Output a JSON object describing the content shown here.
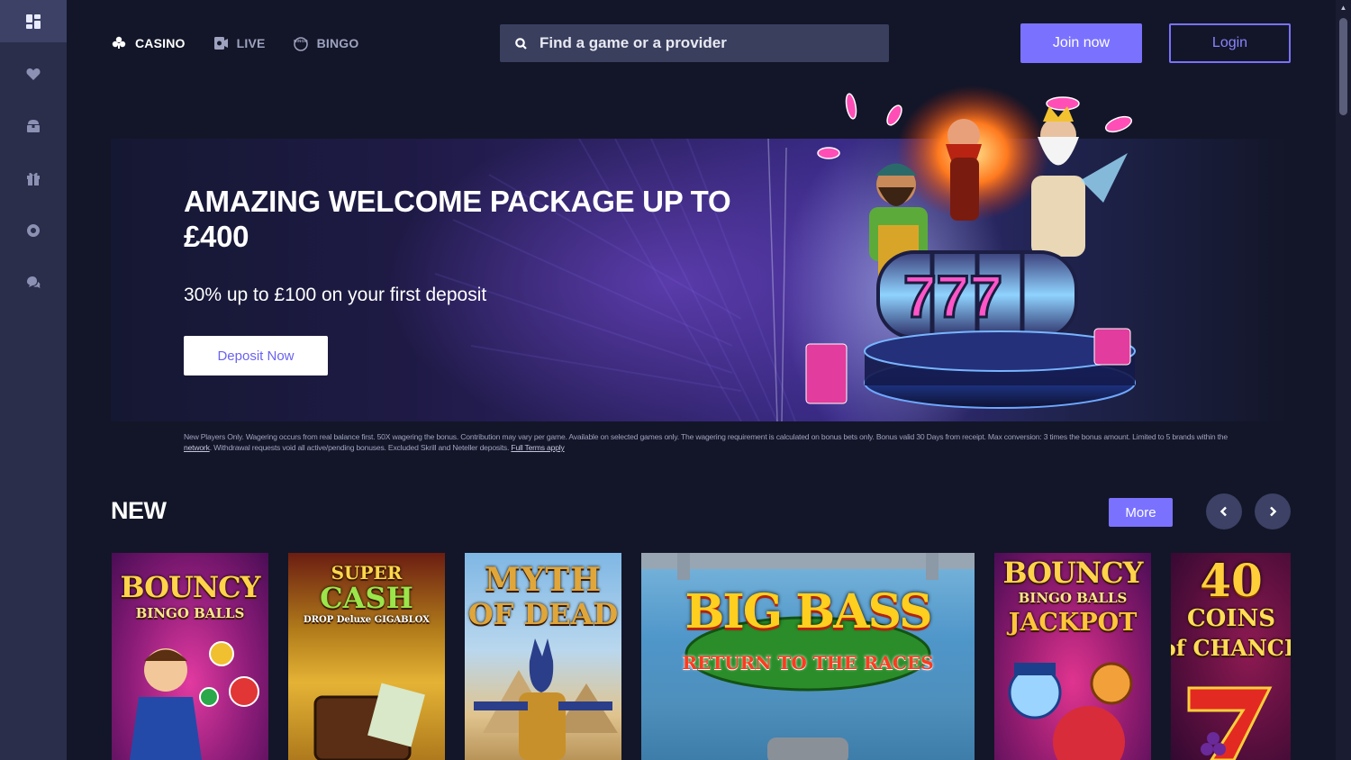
{
  "rail": {
    "items": [
      {
        "name": "games-grid-icon",
        "active": true
      },
      {
        "name": "heart-icon",
        "active": false
      },
      {
        "name": "treasure-chest-icon",
        "active": false
      },
      {
        "name": "gift-icon",
        "active": false
      },
      {
        "name": "lifebuoy-icon",
        "active": false
      },
      {
        "name": "chat-bubbles-icon",
        "active": false
      }
    ]
  },
  "nav": {
    "casino": "CASINO",
    "live": "LIVE",
    "bingo": "BINGO"
  },
  "search": {
    "placeholder": "Find a game or a provider"
  },
  "header": {
    "join_label": "Join now",
    "login_label": "Login"
  },
  "hero": {
    "title": "AMAZING WELCOME PACKAGE UP TO £400",
    "subtitle": "30% up to £100 on your first deposit",
    "cta_label": "Deposit Now",
    "reel_digits": "777"
  },
  "terms": {
    "text_a": "New Players Only. Wagering occurs from real balance first. 50X wagering the bonus. Contribution may vary per game. Available on selected games only. The wagering requirement is calculated on bonus bets only. Bonus valid 30 Days from receipt. Max conversion: 3 times the bonus amount. Limited to 5 brands within the ",
    "network_link": "network",
    "text_b": ". Withdrawal requests void all active/pending bonuses. Excluded Skrill and Neteller deposits. ",
    "full_terms_link": "Full Terms apply"
  },
  "section": {
    "title": "NEW",
    "more_label": "More"
  },
  "games": [
    {
      "line1": "BOUNCY",
      "line2": "BINGO BALLS",
      "line3": ""
    },
    {
      "line1": "SUPER",
      "line2": "CASH",
      "line3": "DROP Deluxe GIGABLOX"
    },
    {
      "line1": "MYTH",
      "line2": "OF DEAD",
      "line3": ""
    },
    {
      "line1": "BIG BASS",
      "line2": "RETURN TO THE RACES",
      "line3": ""
    },
    {
      "line1": "BOUNCY",
      "line2": "BINGO BALLS",
      "line3": "JACKPOT"
    },
    {
      "line1": "40",
      "line2": "COINS",
      "line3": "of CHANCE"
    }
  ],
  "colors": {
    "background": "#131628",
    "rail": "#2a2e4b",
    "accent": "#7a72ff",
    "search_bg": "#3a3f5e"
  }
}
